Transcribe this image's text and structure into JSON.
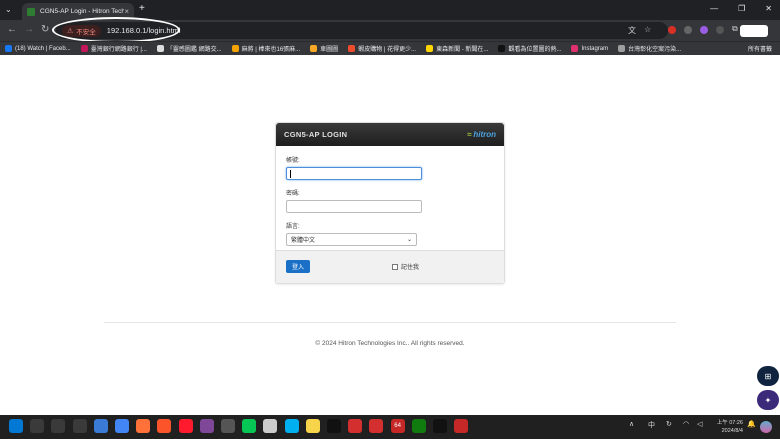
{
  "browser": {
    "tab_title": "CGN5-AP Login - Hitron Techn",
    "tab_menu_icon": "chevron-down-icon",
    "new_tab_label": "+",
    "window_controls": [
      "—",
      "❐",
      "✕"
    ],
    "security_label": "不安全",
    "url": "192.168.0.1/login.html"
  },
  "bookmarks": [
    {
      "label": "(18) Watch | Faceb...",
      "color": "#1877f2"
    },
    {
      "label": "臺灣銀行網路銀行 |...",
      "color": "#c2185b"
    },
    {
      "label": "「靈感圖鑑 網路交...",
      "color": "#dddddd"
    },
    {
      "label": "麻將 | 棒來也16張麻...",
      "color": "#f4a300"
    },
    {
      "label": "車圖圖",
      "color": "#f9a825"
    },
    {
      "label": "蝦皮購物 | 花得更少...",
      "color": "#ee4d2d"
    },
    {
      "label": "東森新聞 - 新聞在...",
      "color": "#ffd600"
    },
    {
      "label": "觀看為位置圖的熱...",
      "color": "#111111"
    },
    {
      "label": "Instagram",
      "color": "#e1306c"
    },
    {
      "label": "台灣彰化空案污染...",
      "color": "#9e9e9e"
    }
  ],
  "all_bookmarks_label": "所有書籤",
  "login": {
    "title": "CGN5-AP LOGIN",
    "logo_text": "hitron",
    "username_label": "帳號:",
    "username_value": "",
    "password_label": "密碼:",
    "password_value": "",
    "language_label": "語言:",
    "language_selected": "繁體中文",
    "login_button": "登入",
    "remember_label": "記住我",
    "remember_checked": false
  },
  "footer": {
    "copyright": "© 2024 Hitron Technologies Inc.. All rights reserved."
  },
  "taskbar": {
    "apps": [
      {
        "name": "windows-start-icon",
        "color": "#0078d4"
      },
      {
        "name": "search-icon",
        "color": "#3a3a3a"
      },
      {
        "name": "task-view-icon",
        "color": "#3a3a3a"
      },
      {
        "name": "widgets-icon",
        "color": "#3a3a3a"
      },
      {
        "name": "photos-icon",
        "color": "#3a7bd5"
      },
      {
        "name": "chrome-icon",
        "color": "#4285f4"
      },
      {
        "name": "firefox-icon",
        "color": "#ff7139"
      },
      {
        "name": "brave-icon",
        "color": "#fb542b"
      },
      {
        "name": "opera-icon",
        "color": "#ff1b2d"
      },
      {
        "name": "tor-browser-icon",
        "color": "#7e4798"
      },
      {
        "name": "calculator-icon",
        "color": "#555555"
      },
      {
        "name": "line-icon",
        "color": "#06c755"
      },
      {
        "name": "calendar-icon",
        "color": "#cccccc"
      },
      {
        "name": "skype-icon",
        "color": "#00aff0"
      },
      {
        "name": "sticky-notes-icon",
        "color": "#f7d44a"
      },
      {
        "name": "tiktok-icon",
        "color": "#111111"
      },
      {
        "name": "flag-icon",
        "color": "#d32f2f"
      },
      {
        "name": "flash-icon",
        "color": "#d32f2f"
      },
      {
        "name": "nox-64-icon",
        "color": "#c62828"
      },
      {
        "name": "xbox-icon",
        "color": "#107c10"
      },
      {
        "name": "capcut-icon",
        "color": "#111111"
      },
      {
        "name": "amd-icon",
        "color": "#c62828"
      }
    ],
    "nox_label": "64",
    "ime": "中",
    "time": "上午 07:26",
    "date": "2024/8/4"
  }
}
